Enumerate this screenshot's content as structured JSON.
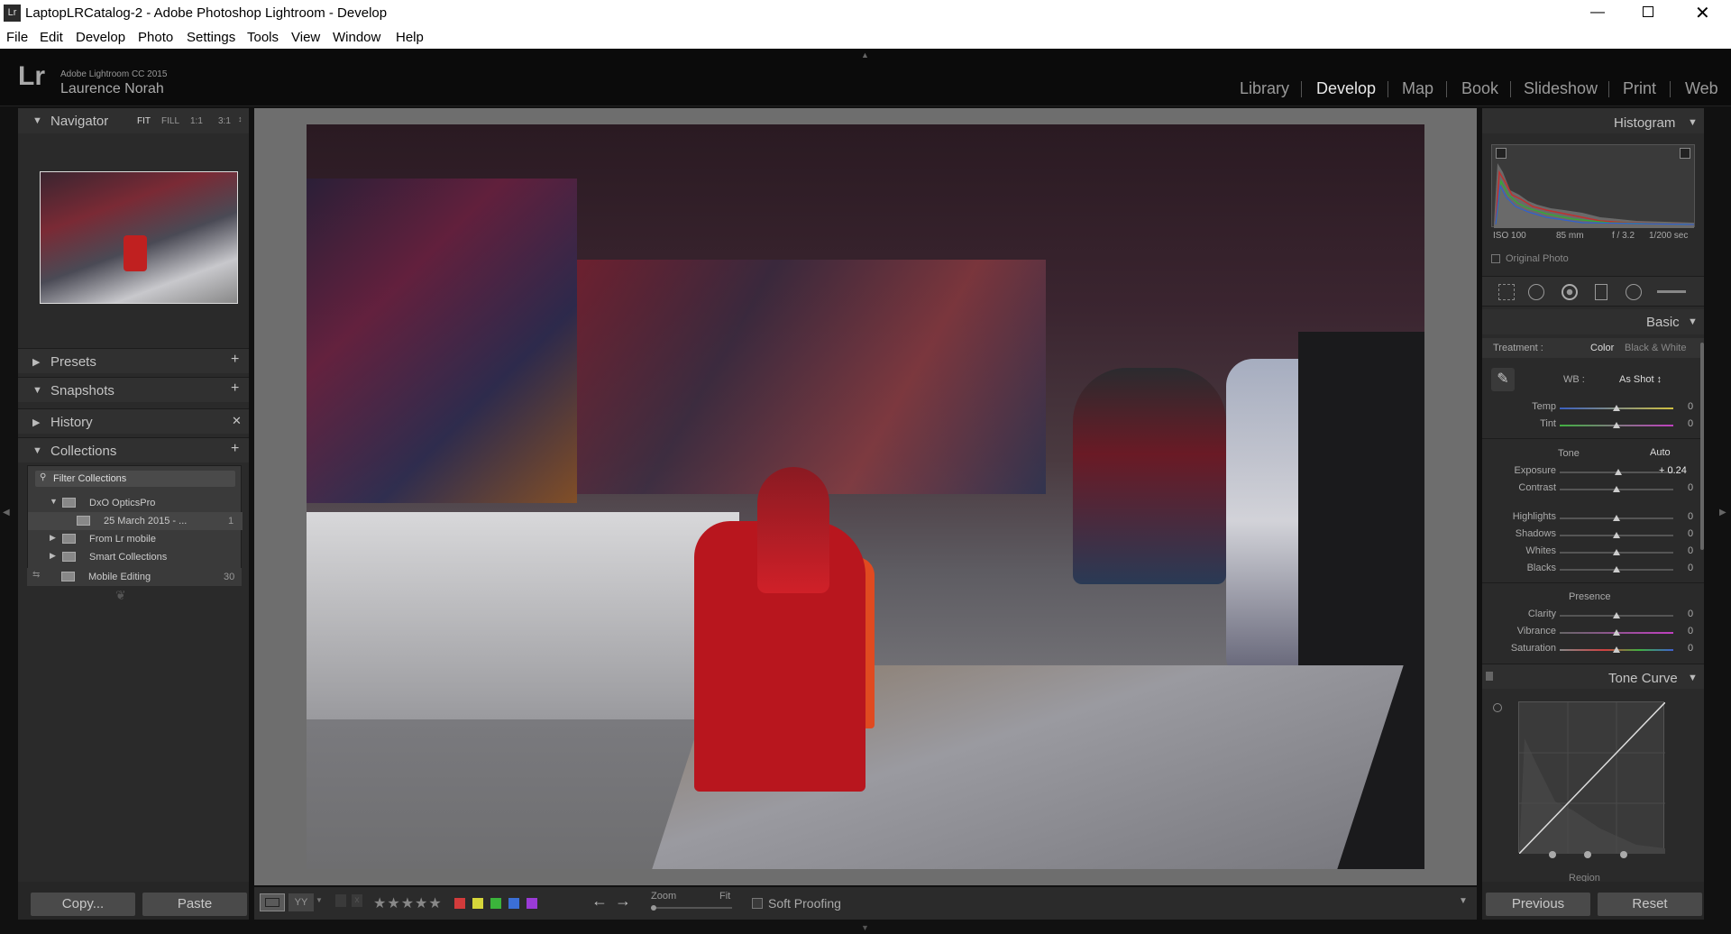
{
  "window": {
    "title": "LaptopLRCatalog-2 - Adobe Photoshop Lightroom - Develop",
    "app_icon": "Lr"
  },
  "menu": [
    "File",
    "Edit",
    "Develop",
    "Photo",
    "Settings",
    "Tools",
    "View",
    "Window",
    "Help"
  ],
  "identity": {
    "logo": "Lr",
    "product": "Adobe Lightroom CC 2015",
    "user": "Laurence Norah"
  },
  "modules": [
    "Library",
    "Develop",
    "Map",
    "Book",
    "Slideshow",
    "Print",
    "Web"
  ],
  "active_module": "Develop",
  "navigator": {
    "title": "Navigator",
    "zoom_options": [
      "FIT",
      "FILL",
      "1:1",
      "3:1"
    ]
  },
  "left_sections": {
    "presets": "Presets",
    "snapshots": "Snapshots",
    "history": "History",
    "collections": "Collections"
  },
  "collections": {
    "filter_placeholder": "Filter Collections",
    "items": [
      {
        "label": "DxO OpticsPro",
        "count": ""
      },
      {
        "label": "25 March 2015 - ...",
        "count": "1"
      },
      {
        "label": "From Lr mobile",
        "count": ""
      },
      {
        "label": "Smart Collections",
        "count": ""
      },
      {
        "label": "Mobile Editing",
        "count": "30"
      }
    ]
  },
  "left_buttons": {
    "copy": "Copy...",
    "paste": "Paste"
  },
  "histogram": {
    "title": "Histogram",
    "iso": "ISO 100",
    "focal": "85 mm",
    "aperture": "f / 3.2",
    "shutter": "1/200 sec",
    "original_photo": "Original Photo"
  },
  "basic": {
    "title": "Basic",
    "treatment_label": "Treatment :",
    "treatment_color": "Color",
    "treatment_bw": "Black & White",
    "wb_label": "WB :",
    "wb_value": "As Shot ↕",
    "tone_label": "Tone",
    "auto": "Auto",
    "presence_label": "Presence",
    "sliders": [
      {
        "label": "Temp",
        "value": "0"
      },
      {
        "label": "Tint",
        "value": "0"
      },
      {
        "label": "Exposure",
        "value": "+ 0.24"
      },
      {
        "label": "Contrast",
        "value": "0"
      },
      {
        "label": "Highlights",
        "value": "0"
      },
      {
        "label": "Shadows",
        "value": "0"
      },
      {
        "label": "Whites",
        "value": "0"
      },
      {
        "label": "Blacks",
        "value": "0"
      },
      {
        "label": "Clarity",
        "value": "0"
      },
      {
        "label": "Vibrance",
        "value": "0"
      },
      {
        "label": "Saturation",
        "value": "0"
      }
    ]
  },
  "tone_curve": {
    "title": "Tone Curve",
    "region": "Region"
  },
  "right_buttons": {
    "previous": "Previous",
    "reset": "Reset"
  },
  "toolbar": {
    "zoom_label": "Zoom",
    "zoom_value": "Fit",
    "soft_proofing": "Soft Proofing",
    "stars": "★★★★★"
  },
  "color_labels": [
    "#d23b3b",
    "#d6d63a",
    "#3bb43b",
    "#3b6fd6",
    "#9a3bd6"
  ]
}
